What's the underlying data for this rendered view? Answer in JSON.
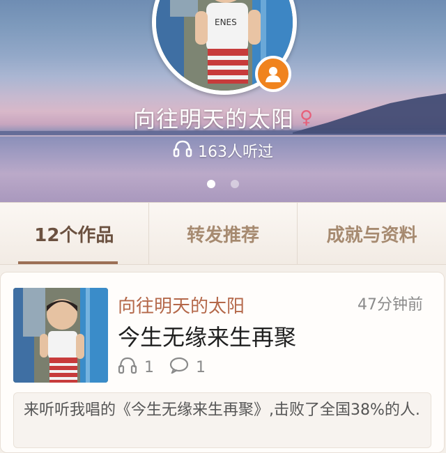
{
  "profile": {
    "name": "向往明天的太阳",
    "gender_symbol": "♀",
    "listens": "163人听过",
    "badge_icon": "user-icon",
    "pager_count": 2,
    "pager_active": 0
  },
  "tabs": [
    {
      "label": "12个作品",
      "active": true
    },
    {
      "label": "转发推荐",
      "active": false
    },
    {
      "label": "成就与资料",
      "active": false
    }
  ],
  "post": {
    "author": "向往明天的太阳",
    "time": "47分钟前",
    "title": "今生无缘来生再聚",
    "listen_count": "1",
    "comment_count": "1",
    "description": "来听听我唱的《今生无缘来生再聚》,击败了全国38%的人."
  },
  "colors": {
    "accent_orange": "#f0831e",
    "author_color": "#b4684a",
    "tab_active": "#6b5140",
    "tab_inactive": "#a68a70",
    "gender_pink": "#e6607a"
  }
}
